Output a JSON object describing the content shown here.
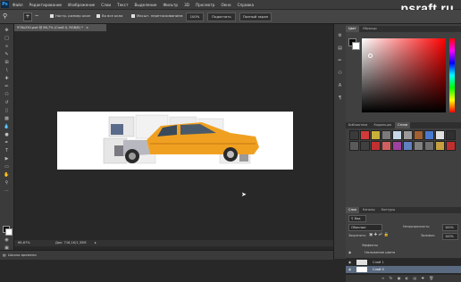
{
  "app": {
    "logo": "Ps"
  },
  "menu": [
    "Файл",
    "Редактирование",
    "Изображение",
    "Слои",
    "Текст",
    "Выделение",
    "Фильтр",
    "3D",
    "Просмотр",
    "Окно",
    "Справка"
  ],
  "watermark": "psraft.ru",
  "options": {
    "resize_windows_label": "Настр. размер окон",
    "all_windows_label": "Во все окна",
    "scrubby_zoom_label": "Масшт. перетаскиванием",
    "zoom_100_button": "100%",
    "fit_screen_button": "Подогнать",
    "fill_screen_button": "Полный экран"
  },
  "document": {
    "tab_title": "978x250.psd @ 66,7% (Слой 0, RGB/8) *",
    "zoom": "66,67%",
    "doc_size": "Док: 716,1K/1,35M",
    "timeline_label": "Шкала времени"
  },
  "panels": {
    "color_tabs": [
      "Цвет",
      "Образцы"
    ],
    "styles_tabs": [
      "Библиотеки",
      "Коррекция",
      "Стили"
    ],
    "layers_tabs": [
      "Слои",
      "Каналы",
      "Контуры"
    ],
    "kind_label": "Вид",
    "blend_mode": "Обычные",
    "opacity_label": "Непрозрачность:",
    "opacity_value": "100%",
    "lock_label": "Закрепить:",
    "fill_label": "Заливка:",
    "fill_value": "100%",
    "effects_label": "Эффекты",
    "effect_item": "Наложение цвета",
    "layers": [
      "Слой 1",
      "Слой 0"
    ]
  },
  "colors": {
    "accent": "#2f6fb5",
    "ps_blue": "#34a7ff",
    "car_body": "#f0a020"
  },
  "style_swatches": [
    "#3a3a3a",
    "#d23a3a",
    "#c8b038",
    "#7a7a7a",
    "#c8d8e8",
    "#9a9a9a",
    "#a06030",
    "#4a7ad0",
    "#e0e0e0",
    "#303030",
    "#5a5a5a",
    "#404040",
    "#c03030",
    "#d06060",
    "#a040a0",
    "#6080c0",
    "#808080",
    "#707070",
    "#c8a040",
    "#bf2f2f"
  ]
}
